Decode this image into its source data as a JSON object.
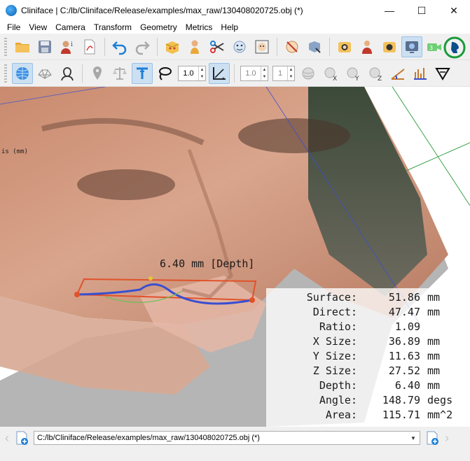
{
  "window": {
    "title": "Cliniface | C:/lb/Cliniface/Release/examples/max_raw/130408020725.obj (*)",
    "minimize": "—",
    "maximize": "☐",
    "close": "✕"
  },
  "menu": [
    "File",
    "View",
    "Camera",
    "Transform",
    "Geometry",
    "Metrics",
    "Help"
  ],
  "toolbar2": {
    "line_width": "1.0",
    "spin_a": "1.0",
    "spin_b": "1"
  },
  "viewport": {
    "depth_label": "6.40 mm [Depth]",
    "axis_label": "is (mm)",
    "metrics": [
      {
        "label": "Surface:",
        "value": "51.86",
        "unit": "mm"
      },
      {
        "label": "Direct:",
        "value": "47.47",
        "unit": "mm"
      },
      {
        "label": "Ratio:",
        "value": "1.09",
        "unit": ""
      },
      {
        "label": "X Size:",
        "value": "36.89",
        "unit": "mm"
      },
      {
        "label": "Y Size:",
        "value": "11.63",
        "unit": "mm"
      },
      {
        "label": "Z Size:",
        "value": "27.52",
        "unit": "mm"
      },
      {
        "label": "Depth:",
        "value": "6.40",
        "unit": "mm"
      },
      {
        "label": "Angle:",
        "value": "148.79",
        "unit": "degs"
      },
      {
        "label": "Area:",
        "value": "115.71",
        "unit": "mm^2"
      }
    ]
  },
  "bottombar": {
    "file_path": "C:/lb/Cliniface/Release/examples/max_raw/130408020725.obj (*)"
  },
  "colors": {
    "accent_blue": "#1e7fd6",
    "active_bg": "#cce0f2",
    "measure_orange": "#e0522a",
    "measure_blue": "#3a4fd0"
  }
}
